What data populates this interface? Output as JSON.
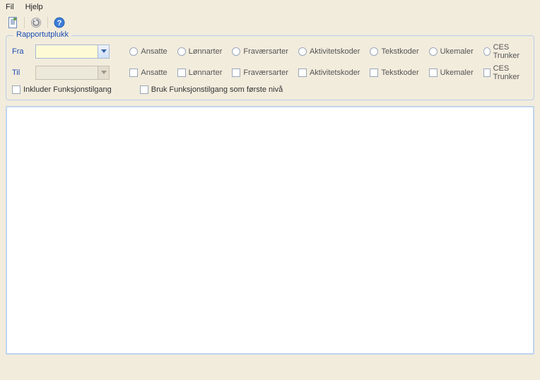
{
  "menu": {
    "file": "Fil",
    "help": "Hjelp"
  },
  "fieldset": {
    "legend": "Rapportutplukk",
    "labels": {
      "from": "Fra",
      "to": "Til"
    },
    "dropdown_from": "",
    "dropdown_to": "",
    "columns": {
      "ansatte": "Ansatte",
      "lonnarter": "Lønnarter",
      "fravaersarter": "Fraværsarter",
      "aktivitetskoder": "Aktivitetskoder",
      "tekstkoder": "Tekstkoder",
      "ukemaler": "Ukemaler",
      "ces_trunker": "CES Trunker"
    },
    "checkbox_include": "Inkluder Funksjonstilgang",
    "checkbox_bruk": "Bruk Funksjonstilgang som første nivå"
  },
  "icons": {
    "doc": "doc-icon",
    "refresh": "refresh-icon",
    "help": "help-icon",
    "chevron": "chevron-down-icon"
  }
}
